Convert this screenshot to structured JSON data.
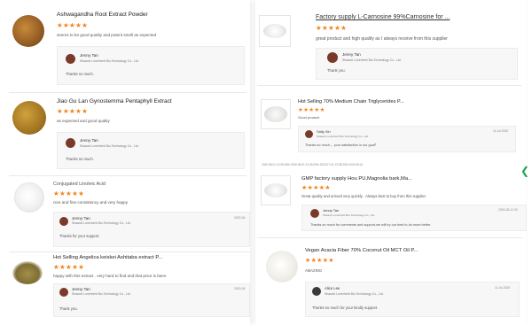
{
  "colors": {
    "star": "#f2841d",
    "accent": "#23a455"
  },
  "left": [
    {
      "title": "Ashwagandha Root Extract Powder",
      "stars": "★★★★★",
      "comment": "seems to be good quality and potent smell as expected",
      "reply_name": "Jenny Tan",
      "reply_company": "Shaanxi Lonerherb Bio-Technology Co., Ltd.",
      "reply_msg": "Thanks so much."
    },
    {
      "title": "Jiao Gu Lan Gynostemma Pentaphyll Extract",
      "stars": "★★★★★",
      "comment": "as expected and good quality",
      "reply_name": "Jenny Tan",
      "reply_company": "Shaanxi Lonerherb Bio-Technology Co., Ltd.",
      "reply_msg": "Thanks so much."
    },
    {
      "title": "Conjugated Linoleic Acid",
      "stars": "★★★★★",
      "comment": "nice and fine consistency and very happy",
      "reply_name": "Jenny Tan",
      "reply_company": "Shaanxi Lonerherb Bio-Technology Co., Ltd.",
      "reply_msg": "Thanks for your support.",
      "reply_date": "2020-06"
    },
    {
      "title": "Hot Selling Angelica keiskei Ashitaba extract P...",
      "stars": "★★★★★",
      "comment": "happy with this extract . very hard to find and that price is been",
      "reply_name": "Jenny Tan",
      "reply_company": "Shaanxi Lonerherb Bio-Technology Co., Ltd.",
      "reply_msg": "Thank you.",
      "reply_date": "2020-06"
    }
  ],
  "right": [
    {
      "title": "Factory supply L-Carnosine 99%Carnosine for ...",
      "stars": "★★★★★",
      "comment": "great product and high quality as I always receive from this supplier",
      "reply_name": "Jenny Tan",
      "reply_company": "Shaanxi Lonerherb Bio-Technology Co., Ltd.",
      "reply_msg": "Thank you."
    },
    {
      "title": "Hot Selling 70% Medium Chain Triglycerides P...",
      "stars": "★★★★★",
      "comment": "Good product",
      "reply_name": "Sally Xin",
      "reply_company": "Shaanxi Lonerherb Bio-Technology Co., Ltd.",
      "reply_msg": "Thanks so much ，your satisfaction is our goal！",
      "reply_date": "11.Jul.2020"
    },
    {
      "title": "GMP factory supply Hou PU,Magnolia bark,Ma...",
      "stars": "★★★★★",
      "comment": "Great quality and arrived very quickly . Always best to buy from this supplier",
      "reply_name": "Jenny Tan",
      "reply_company": "Shaanxi Lonerherb Bio-Technology Co., Ltd.",
      "reply_msg": "Thanks so much for comments and support,we will try our best to do more better.",
      "reply_date": "2020-08-11 00"
    },
    {
      "title": "Vegan Acacia Fiber 70% Coconut Oil MCT Oil P...",
      "stars": "★★★★★",
      "comment": "AMAZING",
      "reply_name": "Alice Lee",
      "reply_company": "Shaanxi Lonerherb Bio-Technology Co., Ltd.",
      "reply_msg": "Thanks so much for your kindly support.",
      "reply_date": "11.Jul.2020"
    }
  ],
  "timestrip": "2020.08.01 12:35:20th   2020.06.01 12:35:20th   2020.07.01 12:35:20th   2020.06.01"
}
